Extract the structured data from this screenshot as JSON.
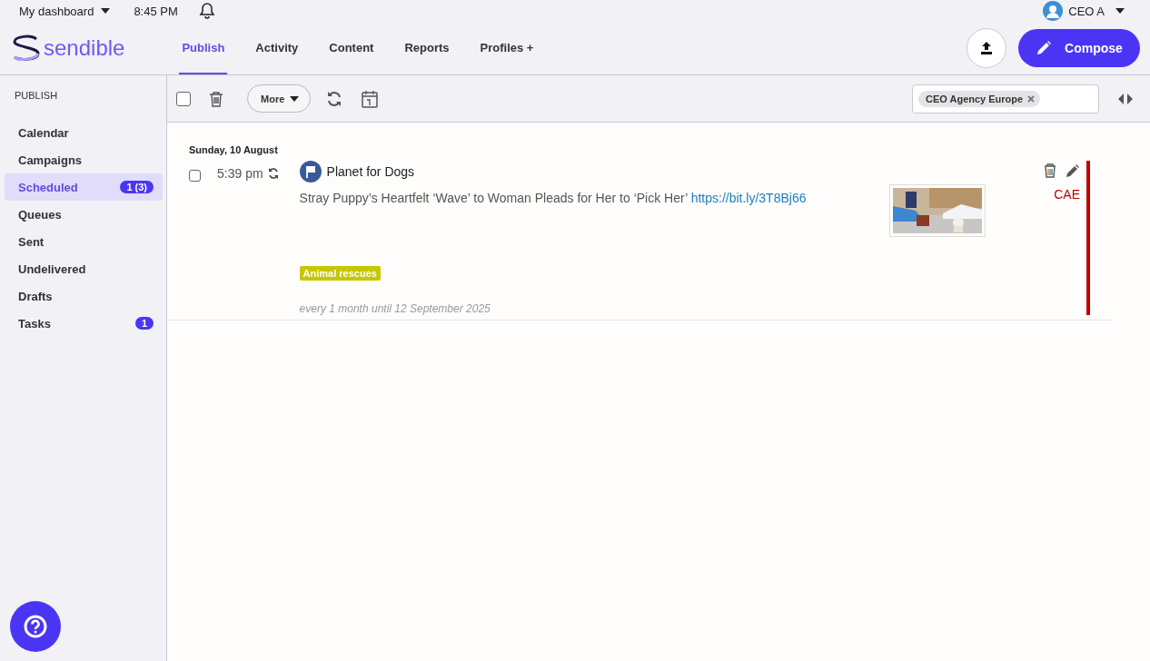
{
  "top_bar": {
    "dashboard": "My dashboard",
    "time": "8:45 PM",
    "user": "CEO A"
  },
  "nav": {
    "logo": "sendible",
    "tabs": [
      {
        "label": "Publish",
        "selected": true
      },
      {
        "label": "Activity",
        "selected": false
      },
      {
        "label": "Content",
        "selected": false
      },
      {
        "label": "Reports",
        "selected": false
      },
      {
        "label": "Profiles +",
        "selected": false
      }
    ],
    "compose": "Compose"
  },
  "sidebar": {
    "heading": "PUBLISH",
    "items": [
      {
        "label": "Calendar",
        "selected": false
      },
      {
        "label": "Campaigns",
        "selected": false
      },
      {
        "label": "Scheduled",
        "selected": true,
        "badge": "1 (3)"
      },
      {
        "label": "Queues",
        "selected": false
      },
      {
        "label": "Sent",
        "selected": false
      },
      {
        "label": "Undelivered",
        "selected": false
      },
      {
        "label": "Drafts",
        "selected": false
      },
      {
        "label": "Tasks",
        "selected": false,
        "badge": "1"
      }
    ]
  },
  "toolbar": {
    "select_all": {
      "checked": false
    },
    "more": "More",
    "filter_tags": [
      "CEO Agency Europe"
    ]
  },
  "posts": [
    {
      "date": "Sunday, 10 August",
      "checked": false,
      "time": "5:39 pm",
      "profile": "Planet for Dogs",
      "text": "Stray Puppy’s Heartfelt ‘Wave’ to Woman Pleads for Her to ‘Pick Her’",
      "link": "https://bit.ly/3T8Bj66",
      "tags": [
        {
          "label": "Animal rescues",
          "color": "#c5c800"
        }
      ],
      "recurrence": "every 1 month until 12 September 2025",
      "account": {
        "label": "CAE",
        "color": "#c00000"
      }
    }
  ]
}
